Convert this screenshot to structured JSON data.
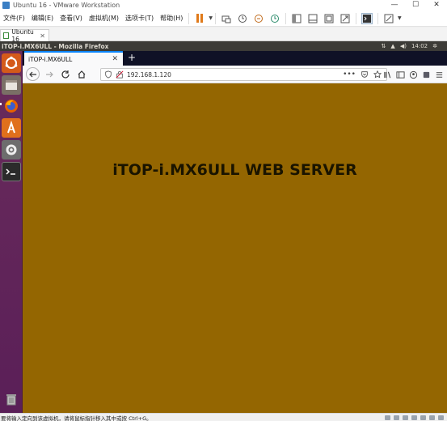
{
  "vmware": {
    "title": "Ubuntu 16 - VMware Workstation",
    "window_controls": [
      "—",
      "☐",
      "✕"
    ],
    "menu": [
      "文件(F)",
      "编辑(E)",
      "查看(V)",
      "虚拟机(M)",
      "选项卡(T)",
      "帮助(H)"
    ],
    "toolbar_icons": [
      "pause-icon",
      "send-keys-icon",
      "snapshot-icon",
      "revert-snapshot-icon",
      "manage-snapshots-icon",
      "fit-window-icon",
      "single-view-icon",
      "full-screen-icon",
      "unity-icon",
      "console-view-icon",
      "stretch-icon"
    ],
    "tab": {
      "label": "Ubuntu 16"
    },
    "status_message": "要将输入定向到该虚拟机，请将鼠标指针移入其中或按 Ctrl+G。"
  },
  "ubuntu": {
    "top_panel_title": "iTOP-i.MX6ULL - Mozilla Firefox",
    "indicators": {
      "time": "14:02"
    },
    "launcher_icons": [
      "ubuntu-dash-icon",
      "files-icon",
      "firefox-icon",
      "software-center-icon",
      "system-settings-icon",
      "terminal-icon",
      "trash-icon"
    ]
  },
  "firefox": {
    "tab_title": "iTOP-i.MX6ULL",
    "url": "192.168.1.120",
    "page_heading": "iTOP-i.MX6ULL WEB SERVER",
    "page_background": "#946601"
  }
}
